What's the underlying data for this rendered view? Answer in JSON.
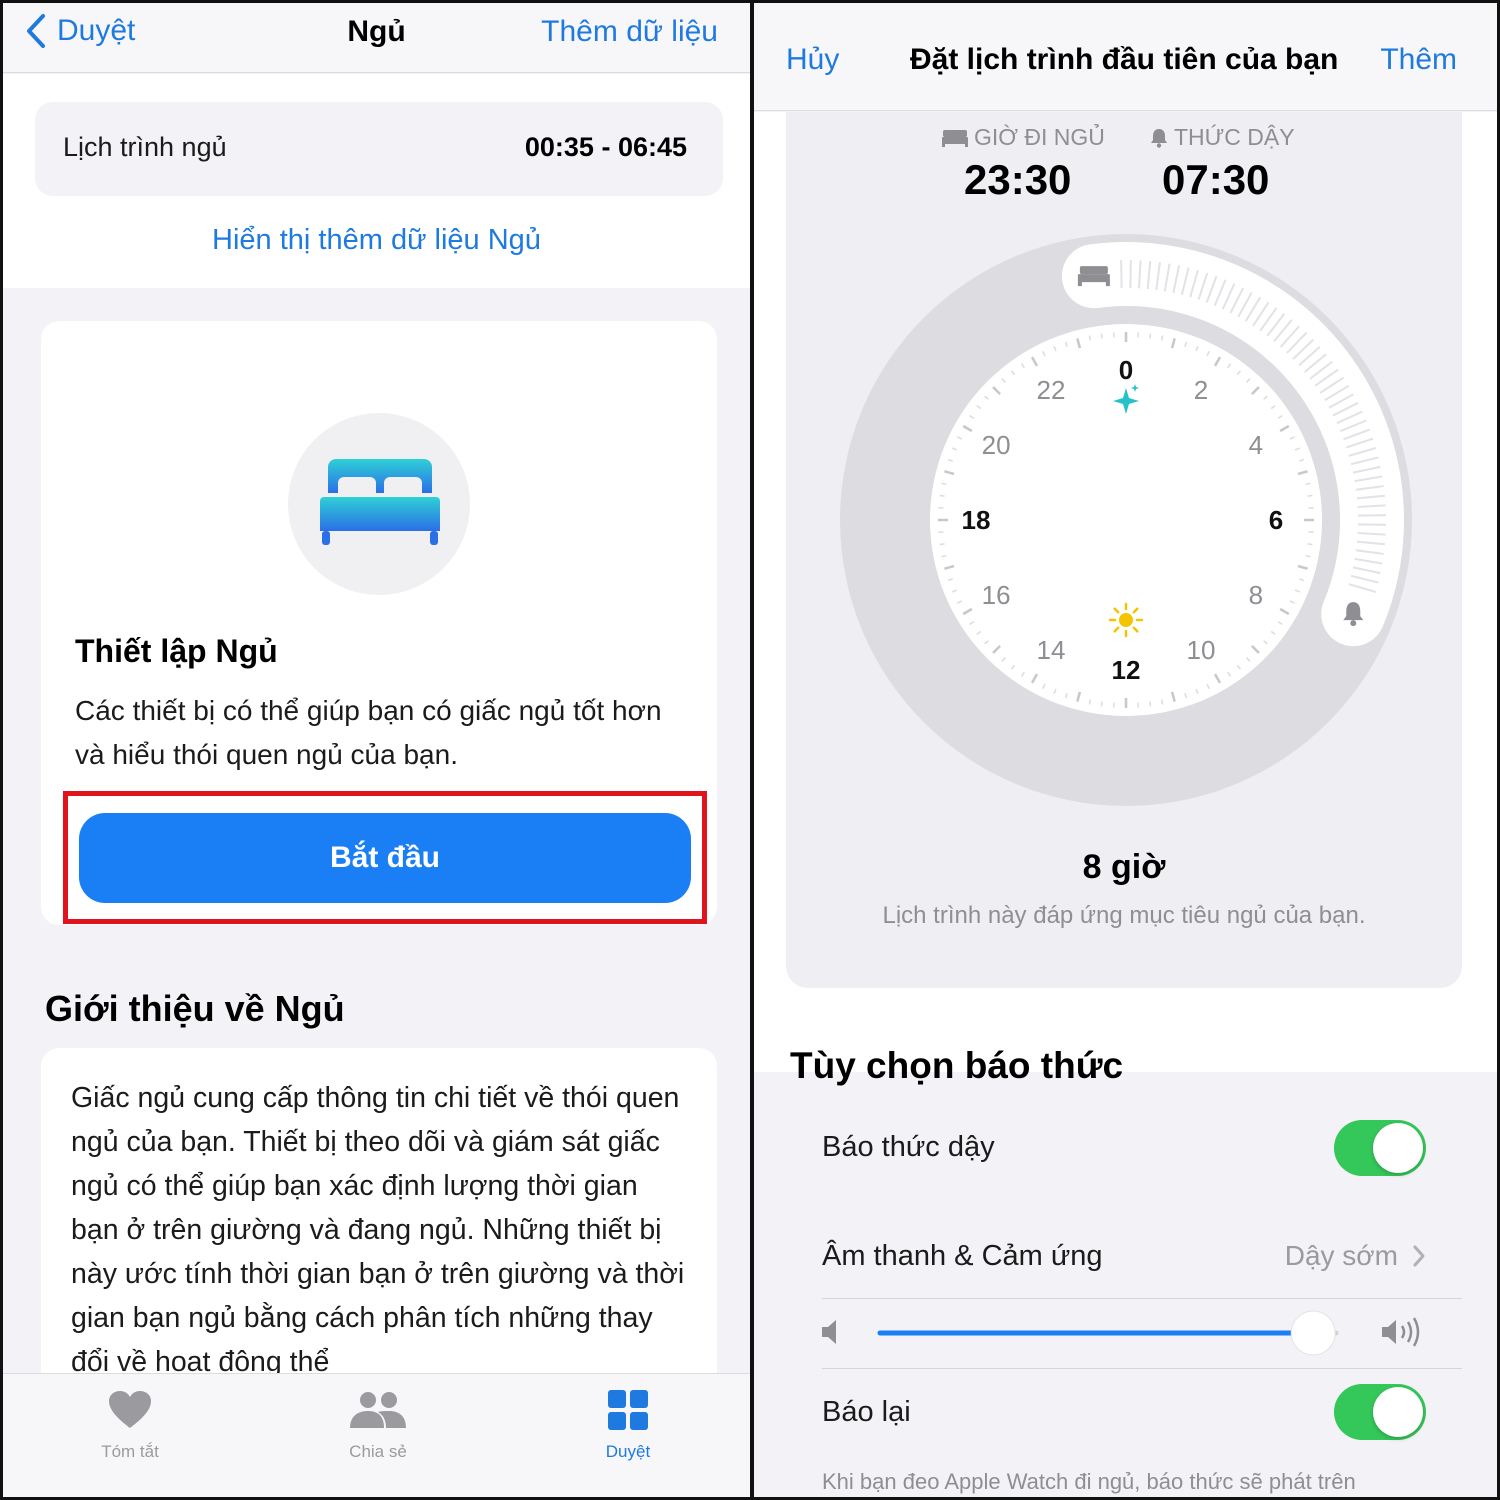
{
  "left": {
    "nav": {
      "back_label": "Duyệt",
      "title": "Ngủ",
      "add_label": "Thêm dữ liệu"
    },
    "schedule": {
      "label": "Lịch trình ngủ",
      "value": "00:35 - 06:45"
    },
    "show_more": "Hiển thị thêm dữ liệu Ngủ",
    "setup": {
      "icon": "bed-icon",
      "title": "Thiết lập Ngủ",
      "description": "Các thiết bị có thể giúp bạn có giấc ngủ tốt hơn và hiểu thói quen ngủ của bạn.",
      "button_label": "Bắt đầu"
    },
    "about": {
      "title": "Giới thiệu về Ngủ",
      "text": "Giấc ngủ cung cấp thông tin chi tiết về thói quen ngủ của bạn. Thiết bị theo dõi và giám sát giấc ngủ có thể giúp bạn xác định lượng thời gian bạn ở trên giường và đang ngủ. Những thiết bị này ước tính thời gian bạn ở trên giường và thời gian bạn ngủ bằng cách phân tích những thay đổi về hoạt động thể"
    },
    "tabs": [
      {
        "label": "Tóm tắt",
        "icon": "heart-icon",
        "active": false
      },
      {
        "label": "Chia sẻ",
        "icon": "people-icon",
        "active": false
      },
      {
        "label": "Duyệt",
        "icon": "grid-icon",
        "active": true
      }
    ]
  },
  "right": {
    "nav": {
      "cancel_label": "Hủy",
      "title": "Đặt lịch trình đầu tiên của bạn",
      "add_label": "Thêm"
    },
    "bedtime": {
      "label": "GIỜ ĐI NGỦ",
      "value": "23:30",
      "icon": "bed-icon"
    },
    "wake": {
      "label": "THỨC DẬY",
      "value": "07:30",
      "icon": "bell-icon"
    },
    "clock": {
      "hour_labels": [
        "0",
        "2",
        "4",
        "6",
        "8",
        "10",
        "12",
        "14",
        "16",
        "18",
        "20",
        "22"
      ],
      "bold_labels": [
        "0",
        "6",
        "12",
        "18"
      ],
      "sleep_start_hour": 23.5,
      "wake_hour": 7.5
    },
    "duration": "8 giờ",
    "duration_note": "Lịch trình này đáp ứng mục tiêu ngủ của bạn.",
    "alarm_options": {
      "title": "Tùy chọn báo thức",
      "wake_alarm": {
        "label": "Báo thức dậy",
        "on": true
      },
      "sound": {
        "label": "Âm thanh & Cảm ứng",
        "value": "Dậy sớm"
      },
      "volume_fraction": 0.95,
      "snooze": {
        "label": "Báo lại",
        "on": true
      },
      "footnote": "Khi bạn đeo Apple Watch đi ngủ, báo thức sẽ phát trên"
    }
  },
  "colors": {
    "accent": "#1f7ae0",
    "button": "#1a7ff5",
    "toggle_on": "#34c759",
    "highlight": "#e0141d"
  }
}
